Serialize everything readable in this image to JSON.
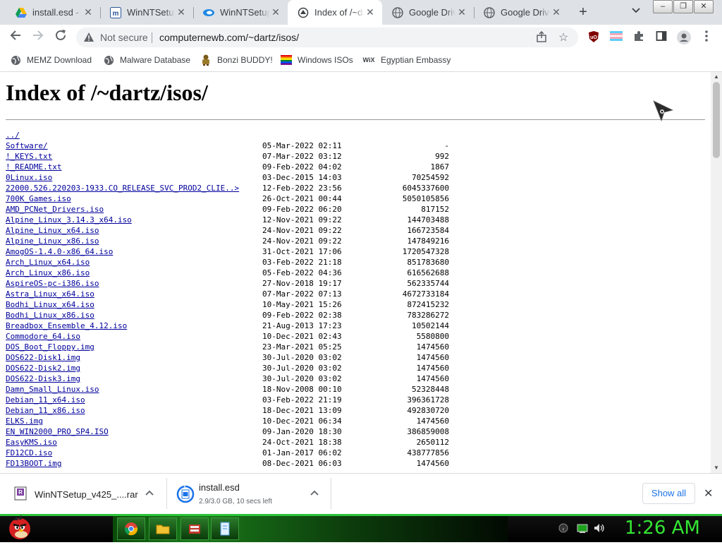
{
  "browser": {
    "tabs": [
      {
        "title": "install.esd - Google Drive",
        "icon": "google-drive-icon"
      },
      {
        "title": "WinNTSetup - MSFN",
        "icon": "msfn-icon"
      },
      {
        "title": "WinNTSetup",
        "icon": "winntsetup-icon"
      },
      {
        "title": "Index of /~dartz/isos/",
        "icon": "server-icon",
        "active": true
      },
      {
        "title": "Google Drive",
        "icon": "globe-icon"
      },
      {
        "title": "Google Drive",
        "icon": "globe-icon"
      }
    ],
    "address": {
      "security": "Not secure",
      "url": "computernewb.com/~dartz/isos/"
    },
    "bookmarks": [
      {
        "label": "MEMZ Download",
        "icon": "globe-icon"
      },
      {
        "label": "Malware Database",
        "icon": "globe-icon"
      },
      {
        "label": "Bonzi BUDDY!",
        "icon": "bonzi-icon"
      },
      {
        "label": "Windows ISOs",
        "icon": "rainbow-flag-icon"
      },
      {
        "label": "Egyptian Embassy",
        "icon": "wix-icon",
        "icon_text": "WiX"
      }
    ]
  },
  "page": {
    "title": "Index of /~dartz/isos/",
    "entries": [
      {
        "name": "../",
        "date": "",
        "size": ""
      },
      {
        "name": "Software/",
        "date": "05-Mar-2022 02:11",
        "size": "-"
      },
      {
        "name": "!_KEYS.txt",
        "date": "07-Mar-2022 03:12",
        "size": "992"
      },
      {
        "name": "!_README.txt",
        "date": "09-Feb-2022 04:02",
        "size": "1867"
      },
      {
        "name": "0Linux.iso",
        "date": "03-Dec-2015 14:03",
        "size": "70254592"
      },
      {
        "name": "22000.526.220203-1933.CO_RELEASE_SVC_PROD2_CLIE..>",
        "date": "12-Feb-2022 23:56",
        "size": "6045337600"
      },
      {
        "name": "700K_Games.iso",
        "date": "26-Oct-2021 00:44",
        "size": "5050105856"
      },
      {
        "name": "AMD_PCNet_Drivers.iso",
        "date": "09-Feb-2022 06:20",
        "size": "817152"
      },
      {
        "name": "Alpine_Linux_3.14.3_x64.iso",
        "date": "12-Nov-2021 09:22",
        "size": "144703488"
      },
      {
        "name": "Alpine_Linux_x64.iso",
        "date": "24-Nov-2021 09:22",
        "size": "166723584"
      },
      {
        "name": "Alpine_Linux_x86.iso",
        "date": "24-Nov-2021 09:22",
        "size": "147849216"
      },
      {
        "name": "AmogOS-1.4.0-x86_64.iso",
        "date": "31-Oct-2021 17:06",
        "size": "1720547328"
      },
      {
        "name": "Arch_Linux_x64.iso",
        "date": "03-Feb-2022 21:18",
        "size": "851783680"
      },
      {
        "name": "Arch_Linux_x86.iso",
        "date": "05-Feb-2022 04:36",
        "size": "616562688"
      },
      {
        "name": "AspireOS-pc-i386.iso",
        "date": "27-Nov-2018 19:17",
        "size": "562335744"
      },
      {
        "name": "Astra_Linux_x64.iso",
        "date": "07-Mar-2022 07:13",
        "size": "4672733184"
      },
      {
        "name": "Bodhi_Linux_x64.iso",
        "date": "10-May-2021 15:26",
        "size": "872415232"
      },
      {
        "name": "Bodhi_Linux_x86.iso",
        "date": "09-Feb-2022 02:38",
        "size": "783286272"
      },
      {
        "name": "Breadbox_Ensemble_4.12.iso",
        "date": "21-Aug-2013 17:23",
        "size": "10502144"
      },
      {
        "name": "Commodore_64.iso",
        "date": "10-Dec-2021 02:43",
        "size": "5580800"
      },
      {
        "name": "DOS_Boot_Floppy.img",
        "date": "23-Mar-2021 05:25",
        "size": "1474560"
      },
      {
        "name": "DOS622-Disk1.img",
        "date": "30-Jul-2020 03:02",
        "size": "1474560"
      },
      {
        "name": "DOS622-Disk2.img",
        "date": "30-Jul-2020 03:02",
        "size": "1474560"
      },
      {
        "name": "DOS622-Disk3.img",
        "date": "30-Jul-2020 03:02",
        "size": "1474560"
      },
      {
        "name": "Damn_Small_Linux.iso",
        "date": "18-Nov-2008 00:10",
        "size": "52328448"
      },
      {
        "name": "Debian_11_x64.iso",
        "date": "03-Feb-2022 21:19",
        "size": "396361728"
      },
      {
        "name": "Debian_11_x86.iso",
        "date": "18-Dec-2021 13:09",
        "size": "492830720"
      },
      {
        "name": "ELKS.img",
        "date": "10-Dec-2021 06:34",
        "size": "1474560"
      },
      {
        "name": "EN_WIN2000_PRO_SP4.ISO",
        "date": "09-Jan-2020 18:30",
        "size": "386859008"
      },
      {
        "name": "EasyKMS.iso",
        "date": "24-Oct-2021 18:38",
        "size": "2650112"
      },
      {
        "name": "FD12CD.iso",
        "date": "01-Jan-2017 06:02",
        "size": "438777856"
      },
      {
        "name": "FD13BOOT.img",
        "date": "08-Dec-2021 06:03",
        "size": "1474560"
      }
    ]
  },
  "downloads": [
    {
      "name": "WinNTSetup_v425_....rar",
      "status": "",
      "icon": "archive-icon"
    },
    {
      "name": "install.esd",
      "status": "2.9/3.0 GB, 10 secs left",
      "icon": "download-progress-icon",
      "progress": 0.97
    }
  ],
  "shelf": {
    "show_all": "Show all"
  },
  "taskbar": {
    "clock": "1:26 AM"
  },
  "colors": {
    "link": "#00009c",
    "taskbar_accent": "#2dc43a",
    "clock": "#33e633",
    "show_all": "#1a73e8"
  }
}
